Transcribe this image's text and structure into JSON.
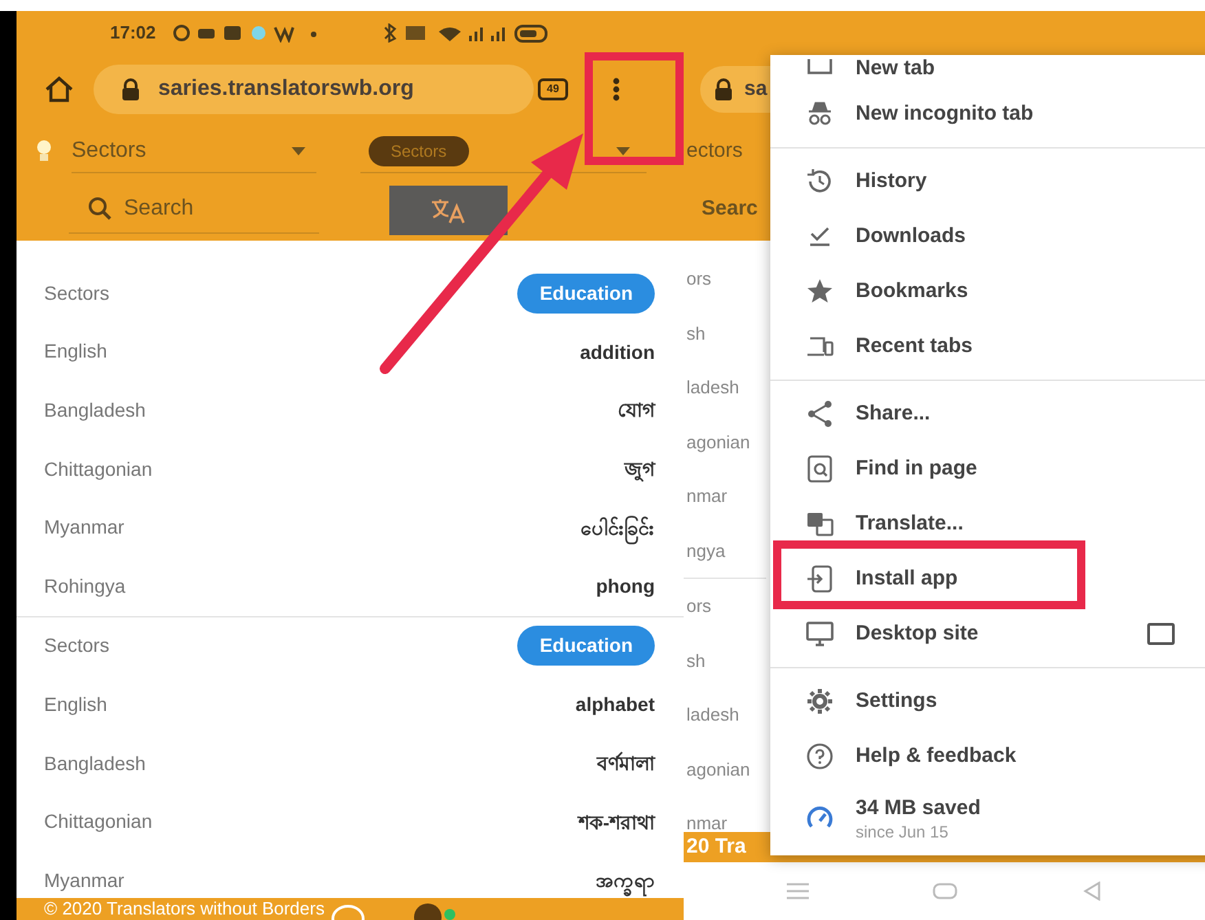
{
  "status_bar": {
    "time": "17:02"
  },
  "address_bar": {
    "url": "saries.translatorswb.org",
    "tab_count": "49"
  },
  "filters": {
    "sector": "Sectors",
    "category_chip": "Sectors",
    "search_placeholder": "Search"
  },
  "groups": [
    {
      "rows": [
        {
          "label": "Sectors",
          "value": "Education",
          "kind": "tag"
        },
        {
          "label": "English",
          "value": "addition",
          "kind": "term"
        },
        {
          "label": "Bangladesh",
          "value": "যোগ",
          "kind": "term"
        },
        {
          "label": "Chittagonian",
          "value": "জুগ",
          "kind": "term"
        },
        {
          "label": "Myanmar",
          "value": "ပေါင်းခြင်း",
          "kind": "term"
        },
        {
          "label": "Rohingya",
          "value": "phong",
          "kind": "term"
        }
      ]
    },
    {
      "rows": [
        {
          "label": "Sectors",
          "value": "Education",
          "kind": "tag"
        },
        {
          "label": "English",
          "value": "alphabet",
          "kind": "term"
        },
        {
          "label": "Bangladesh",
          "value": "বর্ণমালা",
          "kind": "term"
        },
        {
          "label": "Chittagonian",
          "value": "শক-শরাথা",
          "kind": "term"
        },
        {
          "label": "Myanmar",
          "value": "အက္ခရာ",
          "kind": "term"
        }
      ]
    }
  ],
  "footer": {
    "text": "© 2020 Translators without Borders"
  },
  "background_page": {
    "url_fragment": "sa",
    "sector_fragment": "ectors",
    "search_fragment": "Searc",
    "row_groups": [
      [
        "ors",
        "sh",
        "ladesh",
        "agonian",
        "nmar",
        "ngya"
      ],
      [
        "ors",
        "sh",
        "ladesh",
        "agonian",
        "nmar"
      ]
    ],
    "footer_fragment": "20 Tra"
  },
  "menu": {
    "groups": [
      {
        "items": [
          {
            "label": "New tab",
            "kind": "clipped"
          },
          {
            "label": "New incognito tab",
            "kind": "item"
          }
        ]
      },
      {
        "items": [
          {
            "label": "History",
            "kind": "item"
          },
          {
            "label": "Downloads",
            "kind": "item"
          },
          {
            "label": "Bookmarks",
            "kind": "item"
          },
          {
            "label": "Recent tabs",
            "kind": "item"
          }
        ]
      },
      {
        "items": [
          {
            "label": "Share...",
            "kind": "item"
          },
          {
            "label": "Find in page",
            "kind": "item"
          },
          {
            "label": "Translate...",
            "kind": "item"
          },
          {
            "label": "Install app",
            "kind": "item"
          },
          {
            "label": "Desktop site",
            "kind": "checkbox",
            "checked": false
          }
        ]
      },
      {
        "items": [
          {
            "label": "Settings",
            "kind": "item"
          },
          {
            "label": "Help & feedback",
            "kind": "item"
          },
          {
            "label": "34 MB saved",
            "kind": "saved",
            "sublabel": "since Jun 15"
          }
        ]
      }
    ]
  }
}
